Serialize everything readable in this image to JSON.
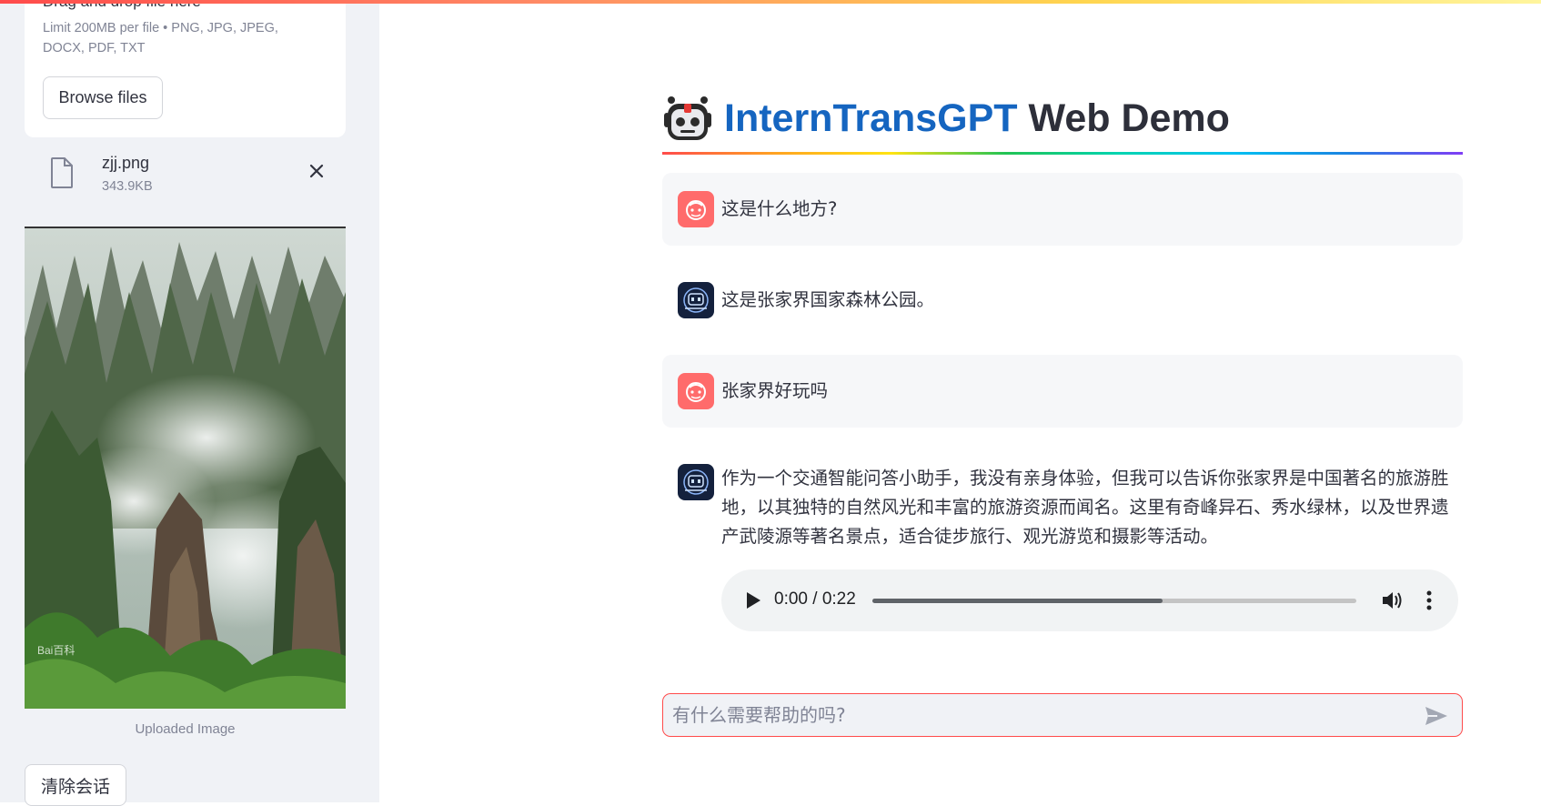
{
  "sidebar": {
    "uploader": {
      "drag_text": "Drag and drop file here",
      "limit_text": "Limit 200MB per file • PNG, JPG, JPEG, DOCX, PDF, TXT",
      "browse_label": "Browse files"
    },
    "file": {
      "name": "zjj.png",
      "size": "343.9KB",
      "icon": "file-icon",
      "close_icon": "close-icon"
    },
    "image": {
      "caption": "Uploaded Image",
      "watermark": "Bai百科"
    },
    "clear_label": "清除会话"
  },
  "header": {
    "title_brand": "InternTransGPT",
    "title_rest": " Web Demo",
    "logo_icon": "robot-icon",
    "brand_color": "#1565c0"
  },
  "messages": [
    {
      "role": "user",
      "avatar": "user-avatar-icon",
      "text": "这是什么地方?"
    },
    {
      "role": "assistant",
      "avatar": "bot-avatar-icon",
      "text": "这是张家界国家森林公园。"
    },
    {
      "role": "user",
      "avatar": "user-avatar-icon",
      "text": "张家界好玩吗"
    },
    {
      "role": "assistant",
      "avatar": "bot-avatar-icon",
      "text": "作为一个交通智能问答小助手，我没有亲身体验，但我可以告诉你张家界是中国著名的旅游胜地，以其独特的自然风光和丰富的旅游资源而闻名。这里有奇峰异石、秀水绿林，以及世界遗产武陵源等著名景点，适合徒步旅行、观光游览和摄影等活动。"
    }
  ],
  "audio": {
    "time": "0:00 / 0:22",
    "progress": 0.6,
    "play_icon": "play-icon",
    "volume_icon": "volume-icon",
    "more_icon": "more-vert-icon"
  },
  "chat_input": {
    "placeholder": "有什么需要帮助的吗?",
    "send_icon": "send-icon"
  },
  "colors": {
    "accent": "#ff4b4b",
    "user_avatar": "#ff6b6b",
    "bot_avatar": "#14213d"
  }
}
